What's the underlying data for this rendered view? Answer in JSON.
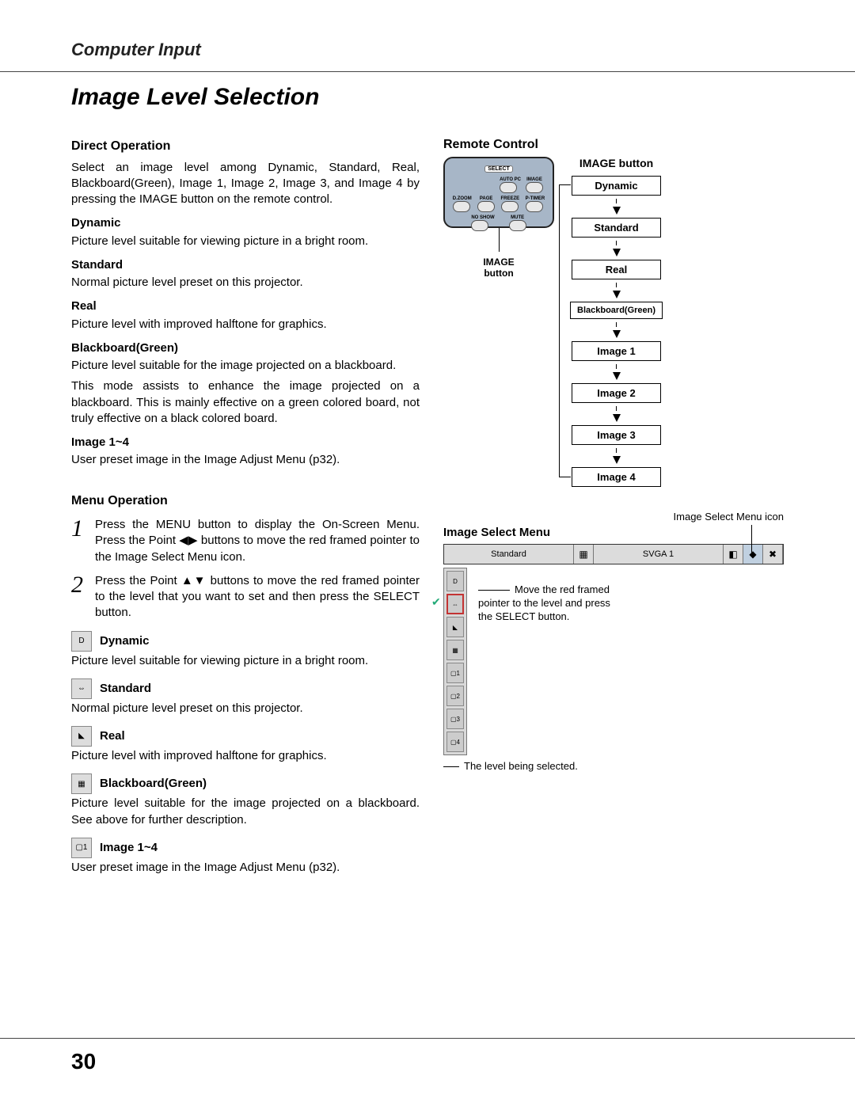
{
  "chapter": "Computer Input",
  "section_title": "Image Level Selection",
  "page_number": "30",
  "direct": {
    "heading": "Direct Operation",
    "intro": "Select an image level among Dynamic, Standard, Real, Blackboard(Green), Image 1, Image 2, Image 3, and Image 4 by pressing the IMAGE button on the remote control.",
    "items": [
      {
        "title": "Dynamic",
        "body": "Picture level suitable for viewing picture in a bright room."
      },
      {
        "title": "Standard",
        "body": "Normal picture level preset on this projector."
      },
      {
        "title": "Real",
        "body": "Picture level with improved halftone for graphics."
      },
      {
        "title": "Blackboard(Green)",
        "body": "Picture level suitable for the image projected on a blackboard.",
        "body2": "This mode assists to enhance the image projected on a blackboard.  This is mainly effective on a green colored board, not truly effective on a black colored board."
      },
      {
        "title": "Image 1~4",
        "body": "User preset image in the Image Adjust Menu (p32)."
      }
    ]
  },
  "menu": {
    "heading": "Menu Operation",
    "steps": [
      "Press the MENU button to display the On-Screen Menu.  Press the Point ◀▶ buttons to move the red framed pointer to the Image Select Menu icon.",
      "Press the Point ▲▼ buttons to move the red framed pointer to the level that you want to set and then press the SELECT button."
    ],
    "items": [
      {
        "title": "Dynamic",
        "body": "Picture level suitable for viewing picture in a bright room."
      },
      {
        "title": "Standard",
        "body": "Normal picture level preset on this projector."
      },
      {
        "title": "Real",
        "body": "Picture level with improved halftone for graphics."
      },
      {
        "title": "Blackboard(Green)",
        "body": "Picture level suitable for the image projected on a blackboard.   See above for further description."
      },
      {
        "title": "Image 1~4",
        "body": "User preset image in the Image Adjust Menu (p32)."
      }
    ]
  },
  "remote": {
    "heading": "Remote Control",
    "select_label": "SELECT",
    "row1": [
      "AUTO PC",
      "IMAGE"
    ],
    "row2": [
      "D.ZOOM",
      "PAGE",
      "FREEZE",
      "P-TIMER"
    ],
    "row3": [
      "NO SHOW",
      "MUTE"
    ],
    "caption": "IMAGE\nbutton",
    "flow_title": "IMAGE button",
    "flow": [
      "Dynamic",
      "Standard",
      "Real",
      "Blackboard(Green)",
      "Image 1",
      "Image 2",
      "Image 3",
      "Image 4"
    ]
  },
  "ism": {
    "icon_caption": "Image Select Menu icon",
    "heading": "Image Select Menu",
    "bar_standard": "Standard",
    "bar_svga": "SVGA 1",
    "note": "Move the red framed pointer to the level and press the SELECT button.",
    "footnote": "The level being selected.",
    "sidebar": [
      "D",
      "⇔",
      "◣",
      "▦",
      "▢1",
      "▢2",
      "▢3",
      "▢4"
    ]
  }
}
